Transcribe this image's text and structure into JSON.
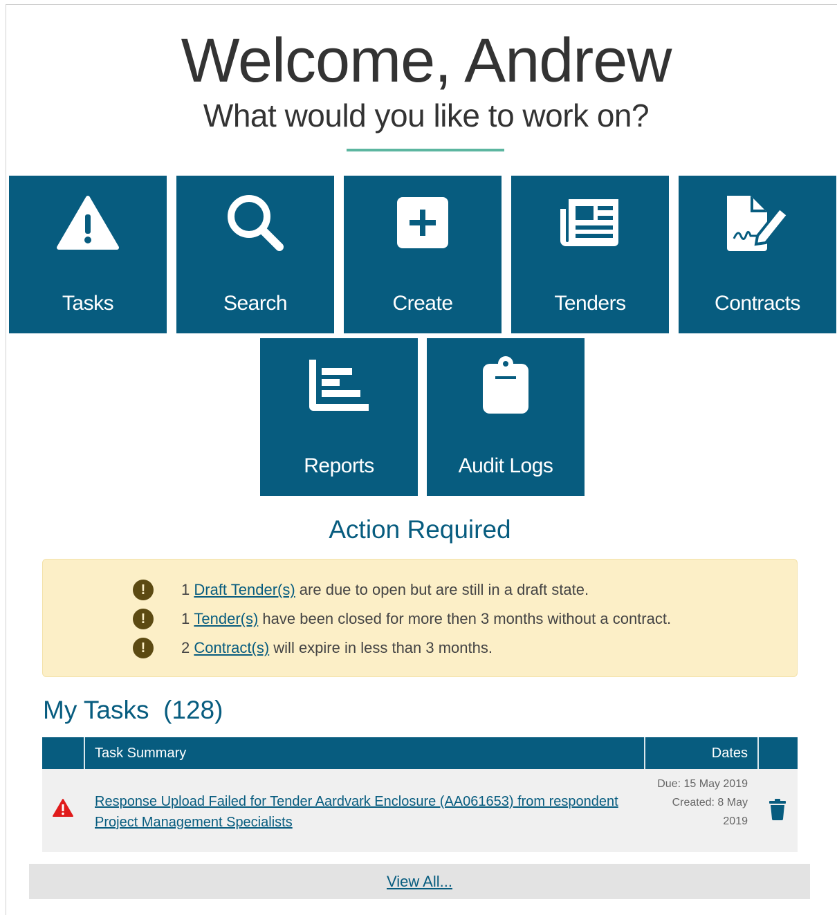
{
  "header": {
    "welcome": "Welcome, Andrew",
    "subtitle": "What would you like to work on?"
  },
  "tiles": {
    "tasks": {
      "label": "Tasks",
      "icon": "warning-icon"
    },
    "search": {
      "label": "Search",
      "icon": "search-icon"
    },
    "create": {
      "label": "Create",
      "icon": "plus-square-icon"
    },
    "tenders": {
      "label": "Tenders",
      "icon": "newspaper-icon"
    },
    "contracts": {
      "label": "Contracts",
      "icon": "file-signature-icon"
    },
    "reports": {
      "label": "Reports",
      "icon": "bar-chart-icon"
    },
    "audit_logs": {
      "label": "Audit Logs",
      "icon": "clipboard-icon"
    }
  },
  "action_required": {
    "title": "Action Required",
    "items": [
      {
        "count": "1",
        "link": "Draft Tender(s)",
        "text": " are due to open but are still in a draft state."
      },
      {
        "count": "1",
        "link": "Tender(s)",
        "text": " have been closed for more then 3 months without a contract."
      },
      {
        "count": "2",
        "link": "Contract(s)",
        "text": " will expire in less than 3 months."
      }
    ]
  },
  "my_tasks": {
    "title": "My Tasks  (128)",
    "columns": {
      "summary": "Task Summary",
      "dates": "Dates"
    },
    "rows": [
      {
        "summary": "Response Upload Failed for Tender Aardvark Enclosure (AA061653) from respondent Project Management Specialists",
        "due": "Due: 15 May 2019",
        "created": "Created: 8 May 2019"
      }
    ],
    "view_all": "View All..."
  },
  "colors": {
    "primary": "#075c7f",
    "accent": "#5cb6a0",
    "alert_bg": "#fcefc7",
    "danger": "#e01b1b"
  }
}
